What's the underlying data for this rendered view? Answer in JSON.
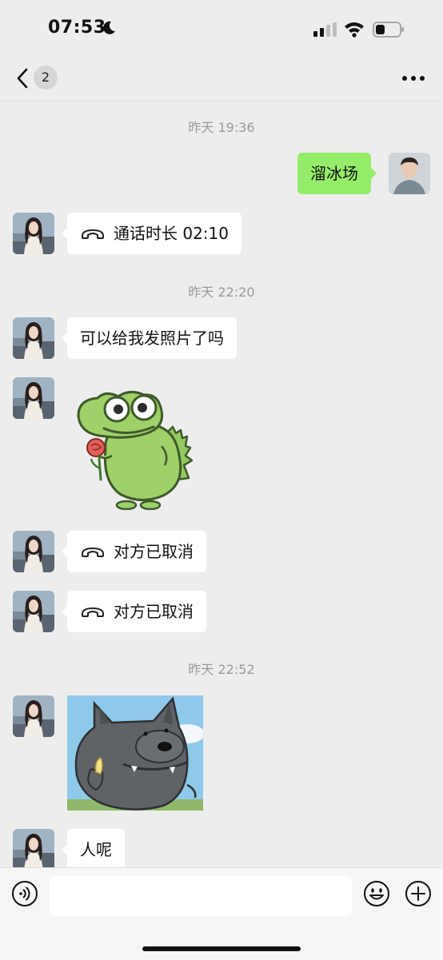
{
  "status_bar": {
    "time": "07:53"
  },
  "nav": {
    "unread_count": "2"
  },
  "messages": [
    {
      "timestamp": "昨天 19:36"
    },
    {
      "sender": "me",
      "text": "溜冰场"
    },
    {
      "sender": "them",
      "type": "call",
      "text": "通话时长 02:10"
    },
    {
      "timestamp": "昨天 22:20"
    },
    {
      "sender": "them",
      "text": "可以给我发照片了吗"
    },
    {
      "sender": "them",
      "type": "sticker",
      "sticker": "green-dinosaur-holding-rose"
    },
    {
      "sender": "them",
      "type": "call",
      "text": "对方已取消"
    },
    {
      "sender": "them",
      "type": "call",
      "text": "对方已取消"
    },
    {
      "timestamp": "昨天 22:52"
    },
    {
      "sender": "them",
      "type": "sticker",
      "sticker": "grey-wolf-holding-banana"
    },
    {
      "sender": "them",
      "text": "人呢"
    }
  ],
  "colors": {
    "background": "#ededed",
    "my_bubble": "#95ec69",
    "their_bubble": "#ffffff",
    "timestamp": "#9a9a9a"
  }
}
